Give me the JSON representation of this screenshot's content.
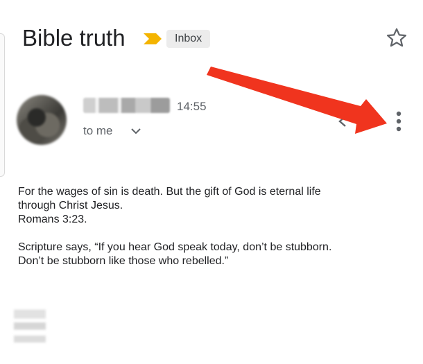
{
  "email": {
    "subject": "Bible truth",
    "label": "Inbox",
    "time": "14:55",
    "recipient": "to me",
    "body": {
      "line1": "For the wages of sin is death. But the gift of God is eternal life",
      "line2": "through Christ Jesus.",
      "line3": "Romans 3:23.",
      "line4": "Scripture says, “If you hear God speak today, don’t be stubborn.",
      "line5": "Don’t be stubborn like those who rebelled.”"
    }
  },
  "icons": {
    "star": "star-outline-icon",
    "importance": "importance-marker-icon",
    "chevron": "chevron-down-icon",
    "reply": "reply-icon",
    "more": "more-vertical-icon",
    "annotation": "red-arrow-annotation"
  },
  "colors": {
    "importance_marker": "#f4b400",
    "annotation_arrow": "#f0341e",
    "label_chip_bg": "#ececec"
  }
}
